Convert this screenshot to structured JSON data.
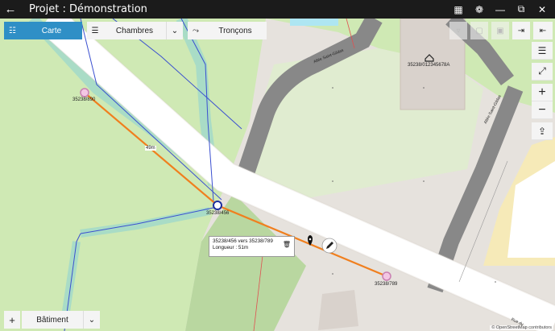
{
  "titlebar": {
    "title": "Projet : Démonstration"
  },
  "toolbar": {
    "carte_label": "Carte",
    "chambres_label": "Chambres",
    "troncons_label": "Tronçons"
  },
  "bottombar": {
    "batiment_label": "Bâtiment",
    "add_label": "+"
  },
  "map": {
    "nodes": [
      {
        "label": "35238/890"
      },
      {
        "label": "35238/456"
      },
      {
        "label": "35238/789"
      }
    ],
    "segment_label": "49m",
    "building_label": "35238/012345678A",
    "street_labels": [
      "Allée Saint-Gildas",
      "Allée Saint-Gildas",
      "Rue du"
    ],
    "popup": {
      "line1": "35238/456 vers 35238/789",
      "line2": "Longueur : 51m"
    },
    "attribution": "© OpenStreetMap contributors"
  },
  "colors": {
    "accent": "#2f8fc6",
    "route": "#f07f1e",
    "grass": "#cfe9b4",
    "buffer": "#a9dcc6",
    "network": "#3a4fd0"
  }
}
